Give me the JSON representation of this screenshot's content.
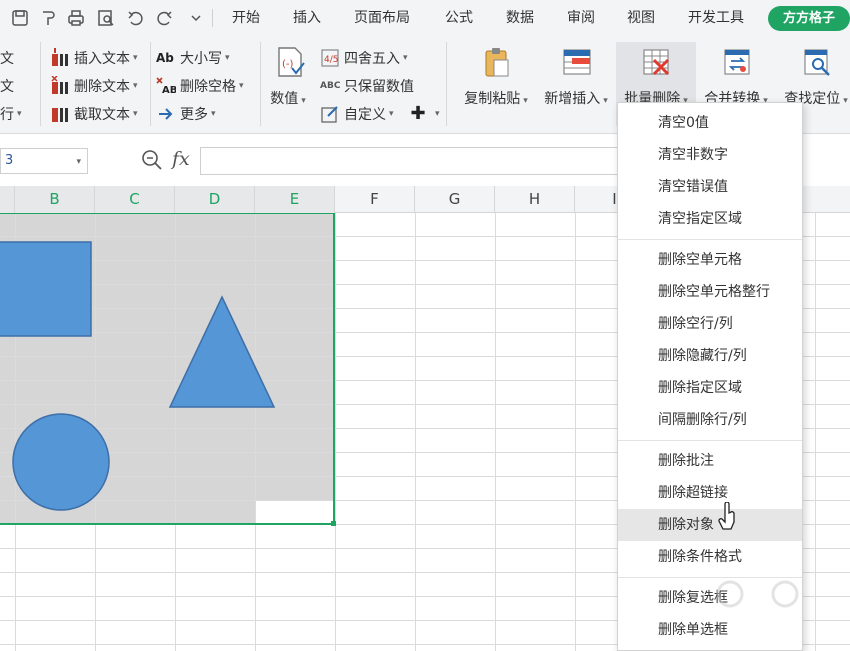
{
  "menubar": {
    "tabs": [
      "开始",
      "插入",
      "页面布局",
      "公式",
      "数据",
      "审阅",
      "视图",
      "开发工具"
    ],
    "brand_tab": "方方格子"
  },
  "ribbon": {
    "cut_left_labels": [
      "文",
      "文",
      "行"
    ],
    "text_group": [
      "插入文本",
      "删除文本",
      "截取文本"
    ],
    "case_group": [
      "大小写",
      "删除空格",
      "更多"
    ],
    "value_button": "数值",
    "round_group": [
      "四舍五入",
      "只保留数值",
      "自定义"
    ],
    "big_buttons": [
      "复制粘贴",
      "新增插入",
      "批量删除",
      "合并转换",
      "查找定位"
    ],
    "active_button": "批量删除"
  },
  "formulabar": {
    "namebox_value": "3",
    "fx_label": "fx",
    "formula_value": ""
  },
  "sheet": {
    "columns": [
      "B",
      "C",
      "D",
      "E",
      "F",
      "G",
      "H",
      "I"
    ],
    "selected_columns": [
      "B",
      "C",
      "D",
      "E"
    ]
  },
  "dropdown": {
    "groups": [
      [
        "清空0值",
        "清空非数字",
        "清空错误值",
        "清空指定区域"
      ],
      [
        "删除空单元格",
        "删除空单元格整行",
        "删除空行/列",
        "删除隐藏行/列",
        "删除指定区域",
        "间隔删除行/列"
      ],
      [
        "删除批注",
        "删除超链接",
        "删除对象",
        "删除条件格式"
      ],
      [
        "删除复选框",
        "删除单选框"
      ]
    ],
    "hovered_item": "删除对象"
  },
  "colors": {
    "accent_green": "#1fa463",
    "shape_fill": "#5596d6",
    "shape_stroke": "#3d6fa8",
    "selection_fill": "#d6d6d6"
  },
  "icons": [
    "save-icon",
    "undo-icon",
    "redo-icon",
    "print-icon",
    "preview-icon",
    "zoom-icon",
    "mouse-cursor-icon"
  ]
}
